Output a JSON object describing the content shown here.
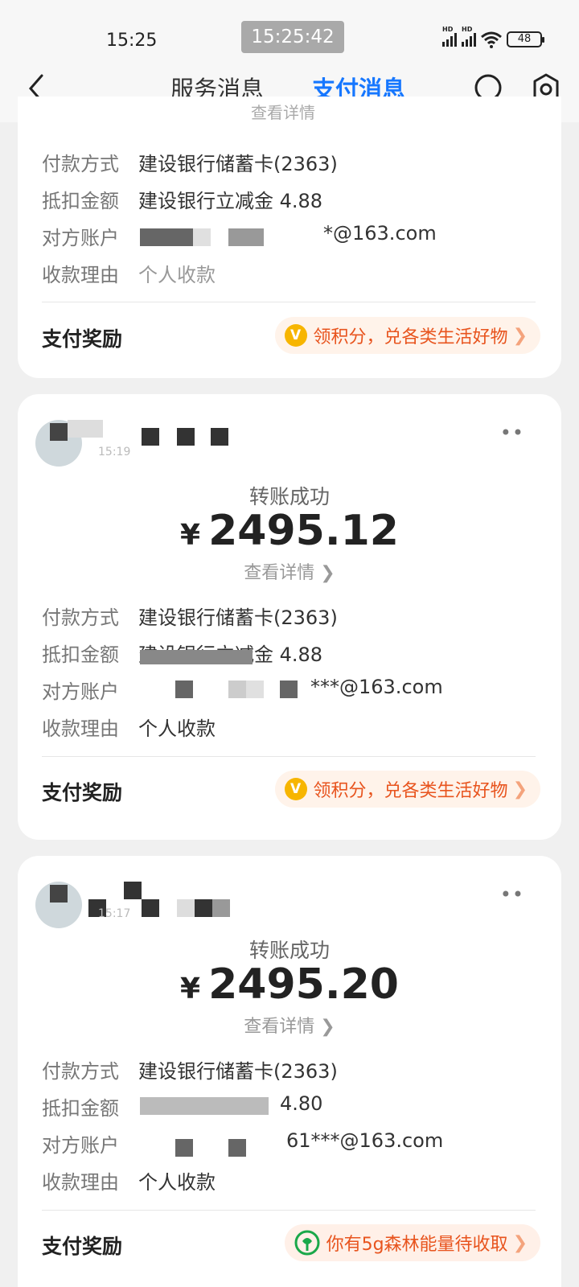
{
  "status_bar": {
    "time": "15:25",
    "clock": "15:25:42",
    "battery": "48",
    "hd": "HD"
  },
  "nav": {
    "tab_service": "服务消息",
    "tab_pay": "支付消息"
  },
  "labels": {
    "pay_method": "付款方式",
    "deduction": "抵扣金额",
    "counterparty": "对方账户",
    "reason": "收款理由",
    "reward": "支付奖励",
    "view_detail": "查看详情",
    "transfer_success": "转账成功"
  },
  "cards": [
    {
      "pay_method": "建设银行储蓄卡(2363)",
      "deduction": "建设银行立减金 4.88",
      "counterparty": "*@163.com",
      "reason": "个人收款",
      "reward": "领积分，兑各类生活好物"
    },
    {
      "time": "15:19",
      "status": "转账成功",
      "currency": "¥",
      "amount": "2495.12",
      "pay_method": "建设银行储蓄卡(2363)",
      "deduction": "建设银行立减金 4.88",
      "counterparty": "***@163.com",
      "reason": "个人收款",
      "reward": "领积分，兑各类生活好物"
    },
    {
      "time": "15:17",
      "status": "转账成功",
      "currency": "¥",
      "amount": "2495.20",
      "pay_method": "建设银行储蓄卡(2363)",
      "deduction": "4.80",
      "counterparty": "61***@163.com",
      "reason": "个人收款",
      "reward": "你有5g森林能量待收取"
    }
  ],
  "icons": {
    "back": "back-chevron-icon",
    "search": "search-icon",
    "settings": "gear-icon",
    "more": "more-icon",
    "coin": "V"
  },
  "colors": {
    "accent": "#1677ff",
    "reward_text": "#e8541e",
    "reward_bg": "#fff3ea"
  }
}
